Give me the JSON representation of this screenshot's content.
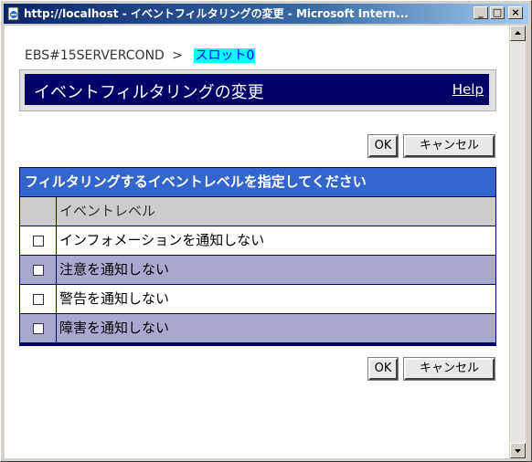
{
  "window": {
    "title": "http://localhost - イベントフィルタリングの変更 - Microsoft Intern...",
    "controls": {
      "minimize": "_",
      "maximize": "□",
      "close": "×"
    }
  },
  "breadcrumb": {
    "parent": "EBS#15SERVERCOND",
    "separator": ">",
    "current": "スロット0"
  },
  "header": {
    "title": "イベントフィルタリングの変更",
    "help": "Help"
  },
  "buttons": {
    "ok": "OK",
    "cancel": "キャンセル"
  },
  "table": {
    "caption": "フィルタリングするイベントレベルを指定してください",
    "column_header": "イベントレベル",
    "rows": [
      {
        "label": "インフォメーションを通知しない",
        "checked": false
      },
      {
        "label": "注意を通知しない",
        "checked": false
      },
      {
        "label": "警告を通知しない",
        "checked": false
      },
      {
        "label": "障害を通知しない",
        "checked": false
      }
    ]
  },
  "colors": {
    "title_bar": "#0a246a",
    "header_bar": "#000066",
    "table_caption": "#3366cc",
    "row_tint": "#a9a9d0",
    "breadcrumb_highlight": "#00ffff"
  },
  "icons": {
    "app": "ie-page-icon",
    "scroll_up": "scroll-up-arrow-icon",
    "scroll_down": "scroll-down-arrow-icon"
  }
}
